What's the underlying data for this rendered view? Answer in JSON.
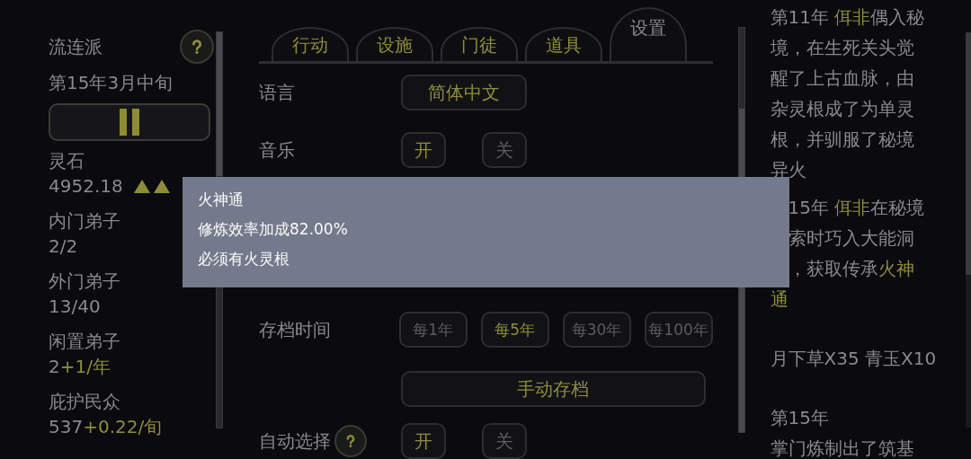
{
  "sect": {
    "name": "流连派",
    "date": "第15年3月中旬"
  },
  "stats": [
    {
      "label": "灵石",
      "value": [
        {
          "text": "4952.18",
          "highlight": false
        }
      ],
      "trend_up": true
    },
    {
      "label": "内门弟子",
      "value": [
        {
          "text": "2/2",
          "highlight": false
        }
      ],
      "trend_up": false
    },
    {
      "label": "外门弟子",
      "value": [
        {
          "text": "13/40",
          "highlight": false
        }
      ],
      "trend_up": false
    },
    {
      "label": "闲置弟子",
      "value": [
        {
          "text": "2",
          "highlight": false
        },
        {
          "text": "+1/年",
          "highlight": true
        }
      ],
      "trend_up": false
    },
    {
      "label": "庇护民众",
      "value": [
        {
          "text": "537",
          "highlight": false
        },
        {
          "text": "+0.22/旬",
          "highlight": true
        }
      ],
      "trend_up": false
    }
  ],
  "tabs": [
    {
      "label": "行动",
      "selected": false
    },
    {
      "label": "设施",
      "selected": false
    },
    {
      "label": "门徒",
      "selected": false
    },
    {
      "label": "道具",
      "selected": false
    },
    {
      "label": "设置",
      "selected": true
    }
  ],
  "settings": [
    {
      "kind": "dropdown",
      "label": "语言",
      "help": false,
      "options": [
        {
          "label": "简体中文",
          "selected": true
        }
      ]
    },
    {
      "kind": "toggle",
      "label": "音乐",
      "help": false,
      "options": [
        {
          "label": "开",
          "selected": true
        },
        {
          "label": "关",
          "selected": false
        }
      ]
    },
    {
      "kind": "hidden"
    },
    {
      "kind": "interval",
      "label": "存档时间",
      "help": false,
      "options": [
        {
          "label": "每1年",
          "selected": false
        },
        {
          "label": "每5年",
          "selected": true
        },
        {
          "label": "每30年",
          "selected": false
        },
        {
          "label": "每100年",
          "selected": false
        }
      ]
    },
    {
      "kind": "action",
      "help": false,
      "options": [
        {
          "label": "手动存档",
          "selected": true
        }
      ]
    },
    {
      "kind": "toggle",
      "label": "自动选择",
      "help": true,
      "options": [
        {
          "label": "开",
          "selected": true
        },
        {
          "label": "关",
          "selected": false
        }
      ]
    }
  ],
  "log": [
    {
      "lines": [
        {
          "covered": false,
          "segments": [
            {
              "text": "第11年 ",
              "highlight": false
            },
            {
              "text": "佴非",
              "highlight": true
            },
            {
              "text": "偶入秘",
              "highlight": false
            }
          ]
        },
        {
          "covered": false,
          "segments": [
            {
              "text": "境，在生死关头觉",
              "highlight": false
            }
          ]
        },
        {
          "covered": false,
          "segments": [
            {
              "text": "醒了上古血脉，由",
              "highlight": false
            }
          ]
        },
        {
          "covered": false,
          "segments": [
            {
              "text": "杂灵根成了为单灵",
              "highlight": false
            }
          ]
        },
        {
          "covered": false,
          "segments": [
            {
              "text": "根，并驯服了秘境",
              "highlight": false
            }
          ]
        },
        {
          "covered": false,
          "segments": [
            {
              "text": "异火",
              "highlight": false
            }
          ]
        }
      ]
    },
    {
      "lines": [
        {
          "covered": true,
          "segments": [
            {
              "text": "15年 ",
              "highlight": false
            },
            {
              "text": "佴非",
              "highlight": true
            },
            {
              "text": "在秘境",
              "highlight": false
            }
          ]
        },
        {
          "covered": true,
          "segments": [
            {
              "text": "索时巧入大能洞",
              "highlight": false
            }
          ]
        },
        {
          "covered": true,
          "segments": [
            {
              "text": "，获取传承",
              "highlight": false
            },
            {
              "text": "火神",
              "highlight": true
            }
          ]
        },
        {
          "covered": false,
          "segments": [
            {
              "text": "通",
              "highlight": true
            }
          ]
        }
      ]
    },
    {
      "lines": [
        {
          "covered": false,
          "segments": [
            {
              "text": "月下草X35 青玉X10",
              "highlight": false
            }
          ]
        }
      ]
    },
    {
      "lines": [
        {
          "covered": false,
          "segments": [
            {
              "text": "第15年",
              "highlight": false
            }
          ]
        },
        {
          "covered": false,
          "segments": [
            {
              "text": "掌门炼制出了筑基",
              "highlight": false
            }
          ]
        }
      ]
    }
  ],
  "tooltip": {
    "title": "火神通",
    "lines": [
      "修炼效率加成82.00%",
      "必须有火灵根"
    ]
  }
}
